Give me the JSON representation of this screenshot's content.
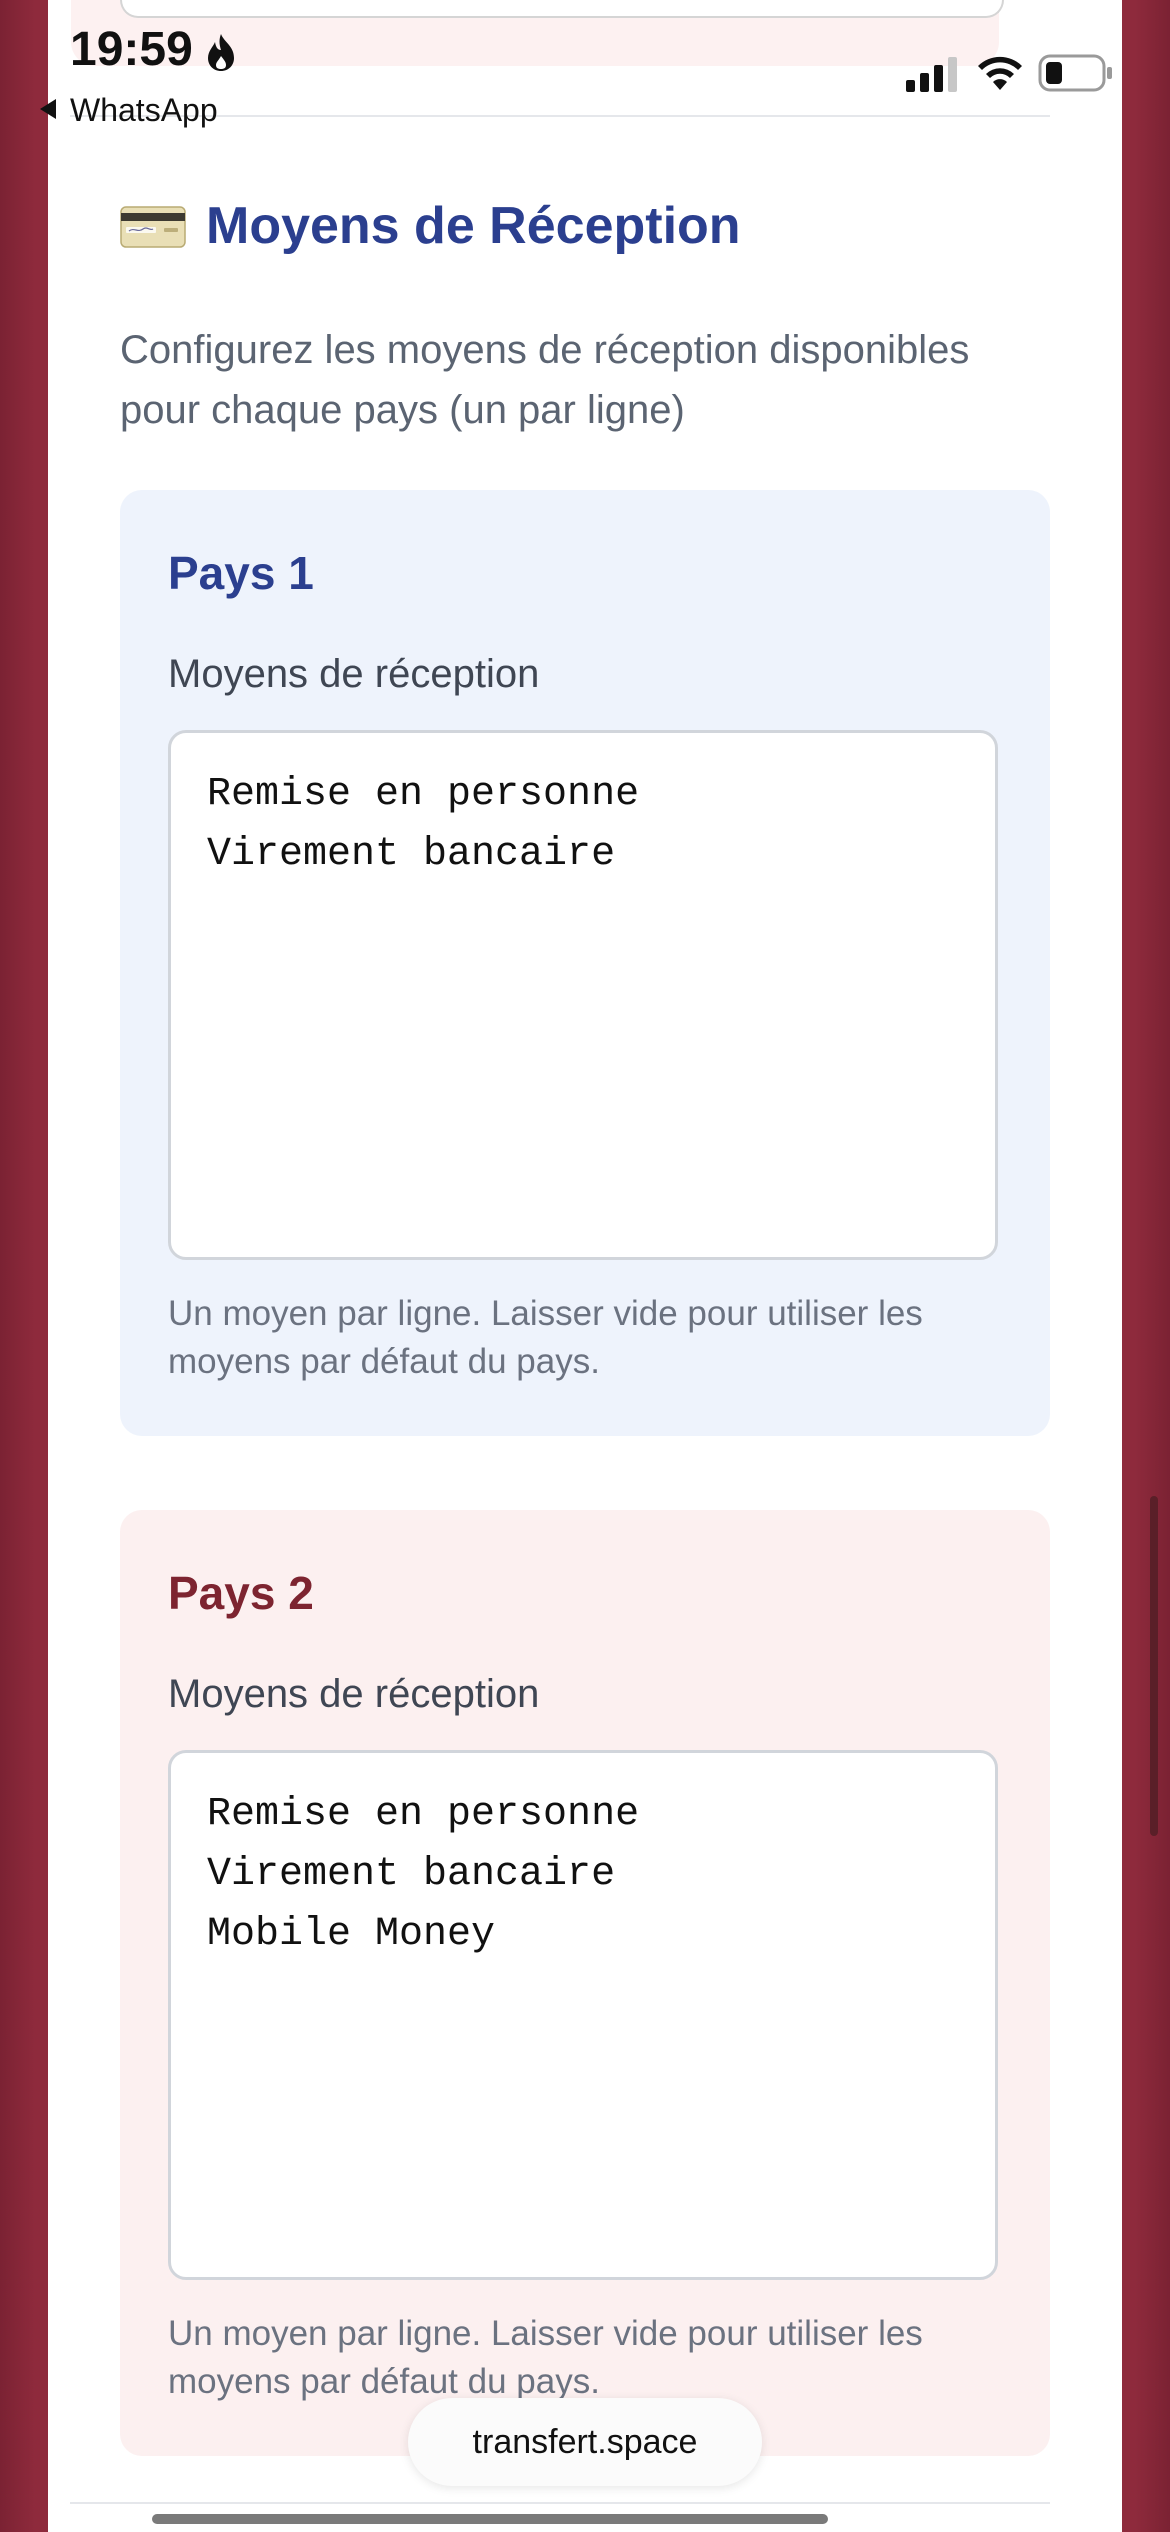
{
  "status_bar": {
    "time": "19:59",
    "back_app": "WhatsApp",
    "icons": [
      "flame-icon",
      "signal-icon",
      "wifi-icon",
      "battery-icon"
    ]
  },
  "section": {
    "icon": "credit-card-icon",
    "title": "Moyens de Réception",
    "description": "Configurez les moyens de réception disponibles pour chaque pays (un par ligne)"
  },
  "countries": [
    {
      "title": "Pays 1",
      "field_label": "Moyens de réception",
      "value": "Remise en personne\nVirement bancaire",
      "help": "Un moyen par ligne. Laisser vide pour utiliser les moyens par défaut du pays."
    },
    {
      "title": "Pays 2",
      "field_label": "Moyens de réception",
      "value": "Remise en personne\nVirement bancaire\nMobile Money",
      "help": "Un moyen par ligne. Laisser vide pour utiliser les moyens par défaut du pays."
    }
  ],
  "browser": {
    "url": "transfert.space"
  },
  "colors": {
    "accent_blue": "#2b3f8f",
    "accent_red": "#7d2430",
    "background_maroon": "#9a2f42",
    "card_blue_bg": "#eef3fc",
    "card_red_bg": "#fcf0f0"
  }
}
